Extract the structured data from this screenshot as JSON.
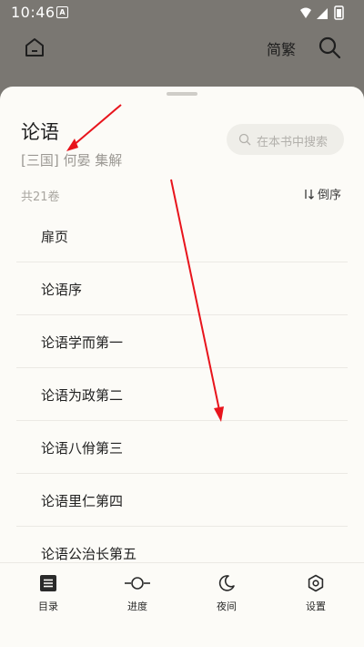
{
  "status_bar": {
    "time": "10:46",
    "notification_badge": "A"
  },
  "top_bar": {
    "lang_toggle": "简繁"
  },
  "book": {
    "title": "论语",
    "author": "[三国] 何晏 集解"
  },
  "search": {
    "placeholder": "在本书中搜索"
  },
  "toc": {
    "volume_count": "共21卷",
    "sort_label": "倒序",
    "items": [
      "扉页",
      "论语序",
      "论语学而第一",
      "论语为政第二",
      "论语八佾第三",
      "论语里仁第四",
      "论语公治长第五"
    ]
  },
  "bottom_nav": {
    "items": [
      {
        "label": "目录",
        "icon": "list-icon"
      },
      {
        "label": "进度",
        "icon": "progress-icon"
      },
      {
        "label": "夜间",
        "icon": "moon-icon"
      },
      {
        "label": "设置",
        "icon": "settings-icon"
      }
    ]
  },
  "colors": {
    "sheet_bg": "#fcfbf7",
    "annotation_arrow": "#e8141c",
    "dim_overlay": "#7a7772"
  }
}
